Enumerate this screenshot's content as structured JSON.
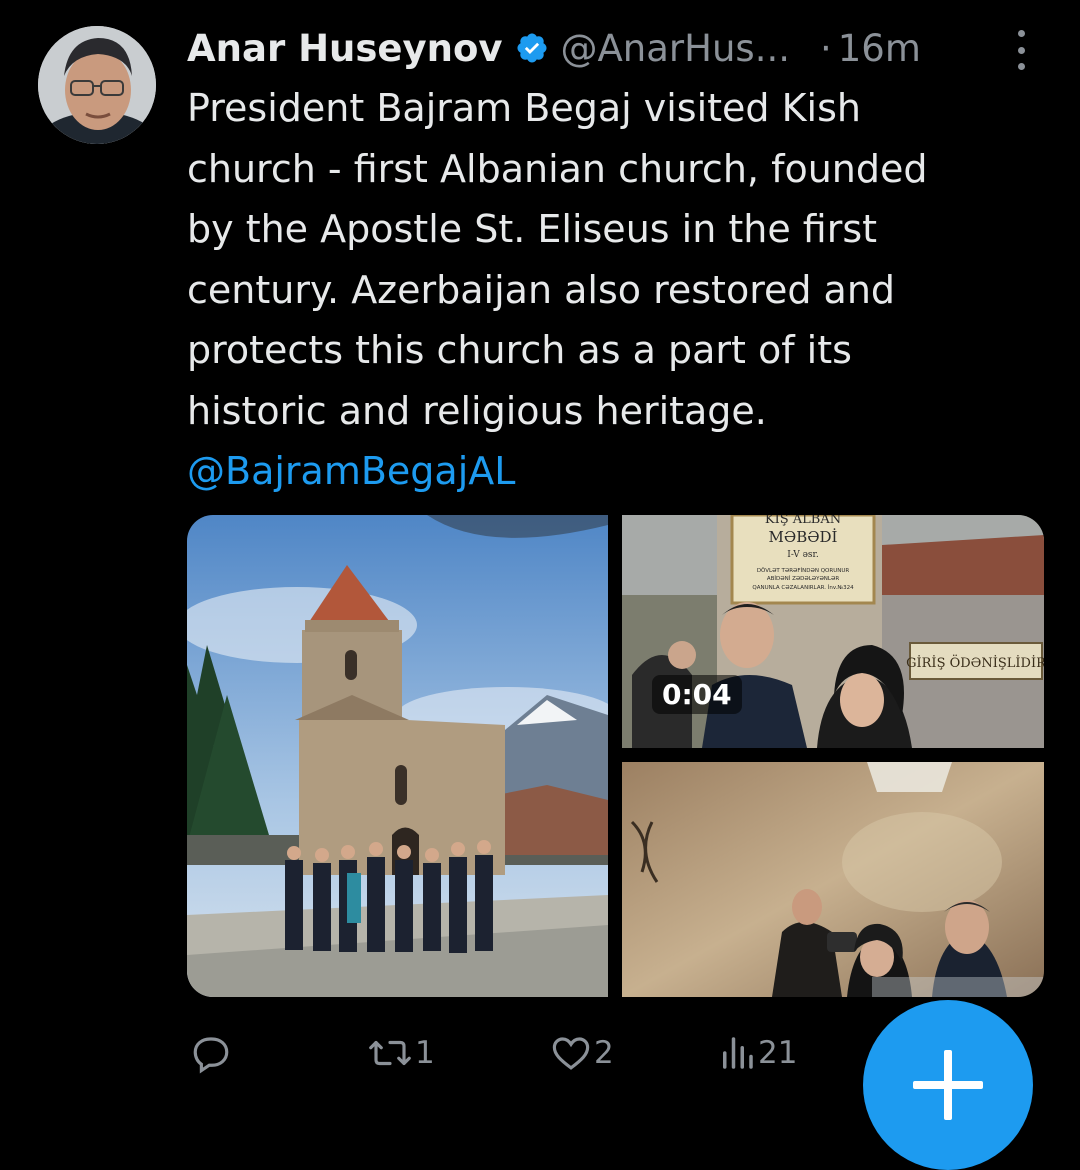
{
  "tweet": {
    "author": {
      "name": "Anar Huseynov",
      "handle": "@AnarHus...",
      "verified": true,
      "time_separator": "·",
      "time": "16m"
    },
    "body_lines": [
      "President Bajram Begaj visited Kish",
      "church - first Albanian church, founded",
      "by the Apostle St. Eliseus in the first",
      "century. Azerbaijan also restored and",
      "protects this church as a part of its",
      "historic and religious heritage."
    ],
    "mention": "@BajramBegajAL",
    "media": {
      "video_duration": "0:04",
      "sign_lines": [
        "KIŞ ALBAN",
        "MƏBƏDİ",
        "I-V əsr.",
        "DÖVLƏT TƏRƏFİNDƏN QORUNUR",
        "ABİDƏNİ ZƏDƏLƏYƏNLƏR",
        "QANUNLA CƏZALANIRLAR.  İnv.№324"
      ],
      "entrance_sign": "GİRİŞ ÖDƏNİŞLİDİR"
    },
    "actions": {
      "reply_count": "",
      "retweet_count": "1",
      "like_count": "2",
      "views_count": "21"
    }
  },
  "colors": {
    "background": "#000000",
    "text": "#e7e9ea",
    "secondary": "#8b9198",
    "accent": "#1d9bf0"
  },
  "icons": [
    "verified-badge-icon",
    "more-icon",
    "reply-icon",
    "retweet-icon",
    "like-icon",
    "views-icon",
    "plus-icon"
  ]
}
